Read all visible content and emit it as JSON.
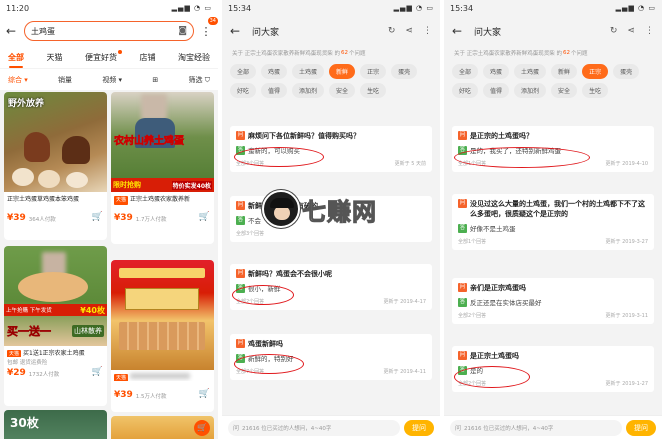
{
  "colors": {
    "accent": "#ff5000",
    "answer_green": "#4caf50",
    "ask_button": "#ffb400",
    "highlight_oval": "#e0181c"
  },
  "search_panel": {
    "status_time": "11:20",
    "search_text": "土鸡蛋",
    "badge_count": "34",
    "tabs": [
      {
        "label": "全部",
        "active": true
      },
      {
        "label": "天猫",
        "active": false
      },
      {
        "label": "便宜好货",
        "active": false,
        "dot": true
      },
      {
        "label": "店铺",
        "active": false
      },
      {
        "label": "淘宝经验",
        "active": false
      }
    ],
    "filters": {
      "sort": "综合",
      "sales": "销量",
      "video": "视频",
      "filter": "筛选"
    },
    "products": [
      {
        "img_text1": "野外放养",
        "title": "正宗土鸡蛋草鸡蛋本笨鸡蛋",
        "price": "39",
        "price_prefix": "¥",
        "sold": "364人付款"
      },
      {
        "img_text1": "农村山养土鸡蛋",
        "img_text2": "限时抢购",
        "img_text3": "特价实发40枚",
        "tag": "天猫",
        "title": "正宗土鸡蛋农家散养新",
        "price": "39",
        "price_prefix": "¥",
        "sold": "1.7万人付款"
      },
      {
        "img_text1": "上午抢購 下午发货",
        "img_text2": "买一送一",
        "img_text3": "¥40枚",
        "img_text4": "山林散养",
        "tag": "天猫",
        "title": "买1送1正宗农家土鸡蛋",
        "price": "29",
        "price_prefix": "¥",
        "sold": "1732人付款",
        "extra_tags": "包邮  退货运费险"
      },
      {
        "tag": "天猫",
        "price": "39",
        "price_prefix": "¥",
        "sold": "1.5万人付款"
      }
    ],
    "bottom_left_text": "30枚"
  },
  "qa_panel_2": {
    "status_time": "15:34",
    "title": "问大家",
    "subheader_prefix": "关于 正宗土鸡蛋农家散养新鲜鸡蛋现货柴 的",
    "question_count": "62",
    "subheader_suffix": "个问题",
    "chips": [
      {
        "label": "全部",
        "active": false
      },
      {
        "label": "鸡蛋",
        "active": false
      },
      {
        "label": "土鸡蛋",
        "active": false
      },
      {
        "label": "新鲜",
        "active": true
      },
      {
        "label": "正宗",
        "active": false
      },
      {
        "label": "蛋壳",
        "active": false
      },
      {
        "label": "好吃",
        "active": false
      },
      {
        "label": "值得",
        "active": false
      },
      {
        "label": "添加剂",
        "active": false
      },
      {
        "label": "安全",
        "active": false
      },
      {
        "label": "生吃",
        "active": false
      }
    ],
    "questions": [
      {
        "question": "麻烦问下各位新鲜吗？值得购买吗？",
        "answer": "蛮新的，可以购买",
        "count": "全部3个回答",
        "date": "更新于 5 天前"
      },
      {
        "question": "新鲜吗？会不会有破的",
        "answer": "不会",
        "count": "全部3个回答",
        "date": ""
      },
      {
        "question": "新鲜吗？鸡蛋会不会很小呢",
        "answer": "很小，新鲜",
        "count": "全部2个回答",
        "date": "更新于 2019-4-17"
      },
      {
        "question": "鸡蛋新鲜吗",
        "answer": "新鲜的，特别好",
        "count": "全部7个回答",
        "date": "更新于 2019-4-11"
      }
    ],
    "ask_hint": "21616 位已买过的人想问，4~40字",
    "ask_button": "提问"
  },
  "qa_panel_3": {
    "status_time": "15:34",
    "title": "问大家",
    "subheader_prefix": "关于 正宗土鸡蛋农家散养新鲜鸡蛋现货柴 的",
    "question_count": "62",
    "subheader_suffix": "个问题",
    "chips": [
      {
        "label": "全部",
        "active": false
      },
      {
        "label": "鸡蛋",
        "active": false
      },
      {
        "label": "土鸡蛋",
        "active": false
      },
      {
        "label": "新鲜",
        "active": false
      },
      {
        "label": "正宗",
        "active": true
      },
      {
        "label": "蛋壳",
        "active": false
      },
      {
        "label": "好吃",
        "active": false
      },
      {
        "label": "值得",
        "active": false
      },
      {
        "label": "添加剂",
        "active": false
      },
      {
        "label": "安全",
        "active": false
      },
      {
        "label": "生吃",
        "active": false
      }
    ],
    "questions": [
      {
        "question": "是正宗的土鸡蛋吗？",
        "answer": "是的，我买了，还特别新鲜鸡蛋",
        "count": "全部1个回答",
        "date": "更新于 2019-4-10"
      },
      {
        "question": "没见过这么大量的土鸡蛋，我们一个村的土鸡都下不了这么多蛋吧，很质疑这个是正宗的",
        "answer": "好像不是土鸡蛋",
        "count": "全部1个回答",
        "date": "更新于 2019-3-27"
      },
      {
        "question": "亲们是正宗鸡蛋吗",
        "answer": "反正还是在实体店买最好",
        "count": "全部2个回答",
        "date": "更新于 2019-3-11"
      },
      {
        "question": "是正宗土鸡蛋吗",
        "answer": "是的",
        "count": "全部2个回答",
        "date": "更新于 2019-1-27"
      }
    ],
    "ask_hint": "21616 位已买过的人想问，4~40字",
    "ask_button": "提问"
  },
  "watermark": {
    "text": "七赚网"
  }
}
